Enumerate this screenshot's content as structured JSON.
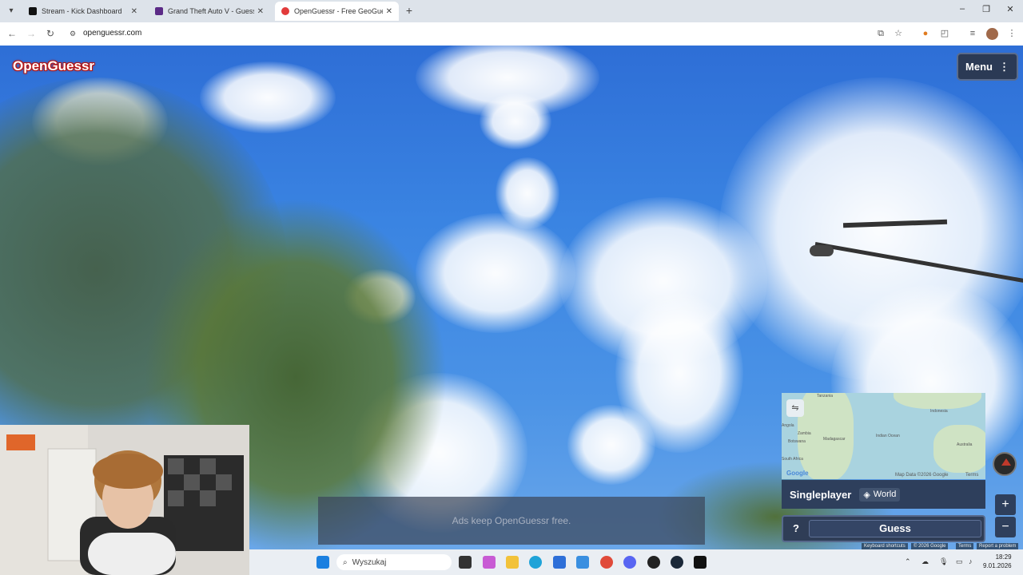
{
  "browser": {
    "tabs": [
      {
        "title": "Stream - Kick Dashboard",
        "active": false,
        "favicon_color": "#111111"
      },
      {
        "title": "Grand Theft Auto V - Guessr - l",
        "active": false,
        "favicon_color": "#5b2a86"
      },
      {
        "title": "OpenGuessr - Free GeoGuessr ·",
        "active": true,
        "favicon_color": "#e23b3b"
      }
    ],
    "url": "openguessr.com",
    "window_controls": [
      "–",
      "❐",
      "✕"
    ]
  },
  "game": {
    "logo": "OpenGuessr",
    "menu_label": "Menu",
    "mode_label": "Singleplayer",
    "map_label": "World",
    "guess_label": "Guess",
    "help_label": "?",
    "ads_text": "Ads keep OpenGuessr free.",
    "map": {
      "labels": [
        "Tanzania",
        "Indonesia",
        "Zambia",
        "Madagascar",
        "Indian Ocean",
        "Australia",
        "Botswana",
        "South Africa",
        "Angola"
      ],
      "attribution": "Map Data ©2026 Google",
      "terms": "Terms",
      "google": "Google"
    },
    "footer": {
      "shortcuts": "Keyboard shortcuts",
      "copyright": "© 2026 Google",
      "terms": "Terms",
      "report": "Report a problem"
    },
    "zoom_in": "+",
    "zoom_out": "−"
  },
  "taskbar": {
    "search_placeholder": "Wyszukaj",
    "time": "18:29",
    "date": "9.01.2026"
  }
}
